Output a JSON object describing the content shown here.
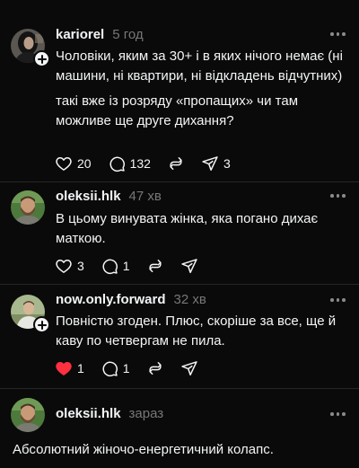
{
  "posts": [
    {
      "username": "kariorel",
      "time": "5 год",
      "avatar": "dark-hair-portrait",
      "follow_button": true,
      "paragraphs": [
        "Чоловіки, яким за 30+ і в яких нічого немає (ні машини, ні квартири, ні відкладень відчутних)",
        "такі вже із розряду «пропащих» чи там можливе ще друге дихання?"
      ],
      "stats": {
        "likes": "20",
        "comments": "132",
        "reposts": "",
        "shares": "3"
      },
      "liked": false
    },
    {
      "username": "oleksii.hlk",
      "time": "47 хв",
      "avatar": "bearded-man-portrait",
      "follow_button": false,
      "paragraphs": [
        "В цьому винувата жінка, яка погано дихає маткою."
      ],
      "stats": {
        "likes": "3",
        "comments": "1",
        "reposts": "",
        "shares": ""
      },
      "liked": false
    },
    {
      "username": "now.only.forward",
      "time": "32 хв",
      "avatar": "outdoor-portrait",
      "follow_button": true,
      "paragraphs": [
        "Повністю згоден. Плюс, скоріше за все, ще й каву по четвергам не пила."
      ],
      "stats": {
        "likes": "1",
        "comments": "1",
        "reposts": "",
        "shares": ""
      },
      "liked": true
    }
  ],
  "reply_composer": {
    "username": "oleksii.hlk",
    "time": "зараз",
    "avatar": "bearded-man-portrait",
    "text": "Абсолютний жіночо-енергетичний колапс."
  },
  "colors": {
    "background": "#0a0a0a",
    "text": "#f3f5f7",
    "muted": "#777777",
    "like_active": "#ff3040"
  }
}
